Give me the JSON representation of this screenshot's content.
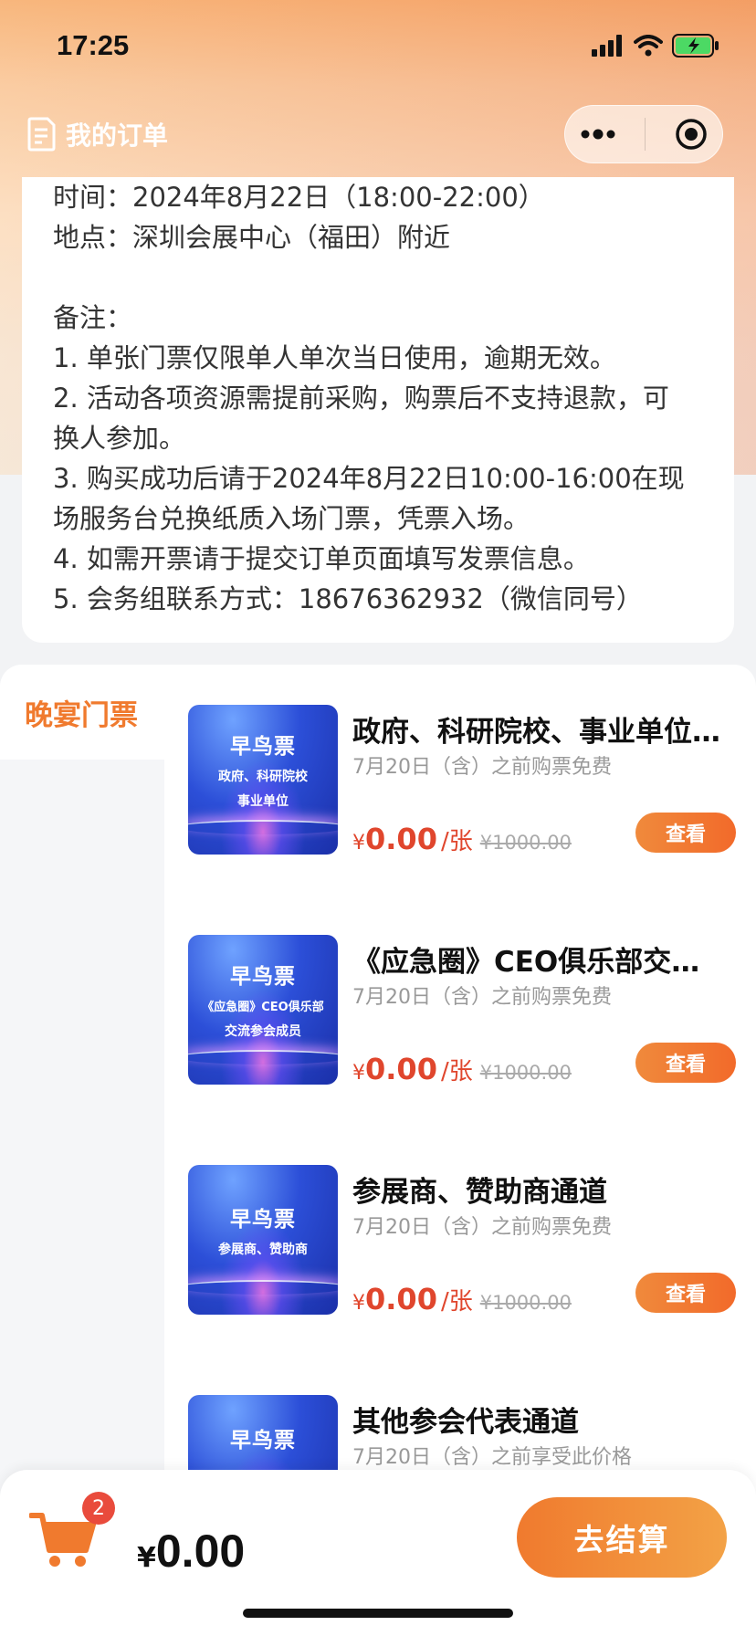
{
  "status_bar": {
    "time": "17:25"
  },
  "nav": {
    "title": "我的订单"
  },
  "event_info": {
    "lines_top": [
      "时间：2024年8月22日（18:00-22:00）",
      "地点：深圳会展中心（福田）附近"
    ],
    "lines_notes": [
      "备注：",
      "1. 单张门票仅限单人单次当日使用，逾期无效。",
      "2. 活动各项资源需提前采购，购票后不支持退款，可",
      "换人参加。",
      "3. 购买成功后请于2024年8月22日10:00-16:00在现",
      "场服务台兑换纸质入场门票，凭票入场。",
      "4. 如需开票请于提交订单页面填写发票信息。",
      "5. 会务组联系方式：18676362932（微信同号）"
    ]
  },
  "sidebar": {
    "active_category": "晚宴门票"
  },
  "tickets": [
    {
      "thumb_title": "早鸟票",
      "thumb_sub_1": "政府、科研院校",
      "thumb_sub_2": "事业单位",
      "name": "政府、科研院校、事业单位…",
      "note": "7月20日（含）之前购票免费",
      "yen": "¥",
      "price": "0.00",
      "unit": "/张",
      "original_price": "¥1000.00",
      "button": "查看"
    },
    {
      "thumb_title": "早鸟票",
      "thumb_sub_1": "《应急圈》CEO俱乐部",
      "thumb_sub_2": "交流参会成员",
      "name": "《应急圈》CEO俱乐部交…",
      "note": "7月20日（含）之前购票免费",
      "yen": "¥",
      "price": "0.00",
      "unit": "/张",
      "original_price": "¥1000.00",
      "button": "查看"
    },
    {
      "thumb_title": "早鸟票",
      "thumb_sub_1": "参展商、赞助商",
      "thumb_sub_2": "",
      "name": "参展商、赞助商通道",
      "note": "7月20日（含）之前购票免费",
      "yen": "¥",
      "price": "0.00",
      "unit": "/张",
      "original_price": "¥1000.00",
      "button": "查看"
    },
    {
      "thumb_title": "早鸟票",
      "thumb_sub_1": "",
      "thumb_sub_2": "",
      "name": "其他参会代表通道",
      "note": "7月20日（含）之前享受此价格"
    }
  ],
  "checkout": {
    "cart_count": "2",
    "currency": "¥",
    "total": "0.00",
    "pay_button": "去结算"
  },
  "colors": {
    "accent": "#f07a2e",
    "price_red": "#e0462d",
    "badge_red": "#e94b3c"
  }
}
